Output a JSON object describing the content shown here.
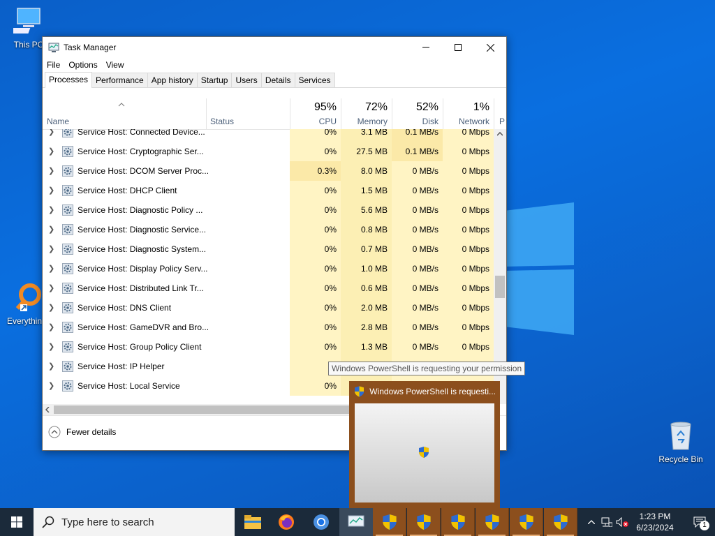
{
  "desktop": {
    "icons": [
      {
        "label": "This PC"
      },
      {
        "label": "Everythin"
      },
      {
        "label": "Recycle Bin"
      }
    ]
  },
  "taskmanager": {
    "title": "Task Manager",
    "menu": [
      "File",
      "Options",
      "View"
    ],
    "tabs": [
      "Processes",
      "Performance",
      "App history",
      "Startup",
      "Users",
      "Details",
      "Services"
    ],
    "columns": {
      "name": "Name",
      "status": "Status",
      "cpu": {
        "pct": "95%",
        "label": "CPU"
      },
      "memory": {
        "pct": "72%",
        "label": "Memory"
      },
      "disk": {
        "pct": "52%",
        "label": "Disk"
      },
      "network": {
        "pct": "1%",
        "label": "Network"
      },
      "power": "P"
    },
    "rows": [
      {
        "name": "Service Host: Connected Device...",
        "cpu": "0%",
        "memory": "3.1 MB",
        "disk": "0.1 MB/s",
        "network": "0 Mbps"
      },
      {
        "name": "Service Host: Cryptographic Ser...",
        "cpu": "0%",
        "memory": "27.5 MB",
        "disk": "0.1 MB/s",
        "network": "0 Mbps"
      },
      {
        "name": "Service Host: DCOM Server Proc...",
        "cpu": "0.3%",
        "memory": "8.0 MB",
        "disk": "0 MB/s",
        "network": "0 Mbps"
      },
      {
        "name": "Service Host: DHCP Client",
        "cpu": "0%",
        "memory": "1.5 MB",
        "disk": "0 MB/s",
        "network": "0 Mbps"
      },
      {
        "name": "Service Host: Diagnostic Policy ...",
        "cpu": "0%",
        "memory": "5.6 MB",
        "disk": "0 MB/s",
        "network": "0 Mbps"
      },
      {
        "name": "Service Host: Diagnostic Service...",
        "cpu": "0%",
        "memory": "0.8 MB",
        "disk": "0 MB/s",
        "network": "0 Mbps"
      },
      {
        "name": "Service Host: Diagnostic System...",
        "cpu": "0%",
        "memory": "0.7 MB",
        "disk": "0 MB/s",
        "network": "0 Mbps"
      },
      {
        "name": "Service Host: Display Policy Serv...",
        "cpu": "0%",
        "memory": "1.0 MB",
        "disk": "0 MB/s",
        "network": "0 Mbps"
      },
      {
        "name": "Service Host: Distributed Link Tr...",
        "cpu": "0%",
        "memory": "0.6 MB",
        "disk": "0 MB/s",
        "network": "0 Mbps"
      },
      {
        "name": "Service Host: DNS Client",
        "cpu": "0%",
        "memory": "2.0 MB",
        "disk": "0 MB/s",
        "network": "0 Mbps"
      },
      {
        "name": "Service Host: GameDVR and Bro...",
        "cpu": "0%",
        "memory": "2.8 MB",
        "disk": "0 MB/s",
        "network": "0 Mbps"
      },
      {
        "name": "Service Host: Group Policy Client",
        "cpu": "0%",
        "memory": "1.3 MB",
        "disk": "0 MB/s",
        "network": "0 Mbps"
      },
      {
        "name": "Service Host: IP Helper",
        "cpu": "0",
        "memory": "",
        "disk": "",
        "network": ""
      },
      {
        "name": "Service Host: Local Service",
        "cpu": "0%",
        "memory": "",
        "disk": "",
        "network": ""
      }
    ],
    "fewer_details": "Fewer details"
  },
  "tooltip": "Windows PowerShell is requesting your permission",
  "preview": {
    "title": "Windows PowerShell is requesti..."
  },
  "taskbar": {
    "search_placeholder": "Type here to search",
    "time": "1:23 PM",
    "date": "6/23/2024",
    "notification_count": "1"
  },
  "colors": {
    "desktop_blue": "#0a6fe0",
    "cpu_tint": "#fff4c4",
    "memory_tint": "#fcefb4",
    "uac_taskbar": "#8c4f1d",
    "taskbar": "#1b2a3a"
  }
}
